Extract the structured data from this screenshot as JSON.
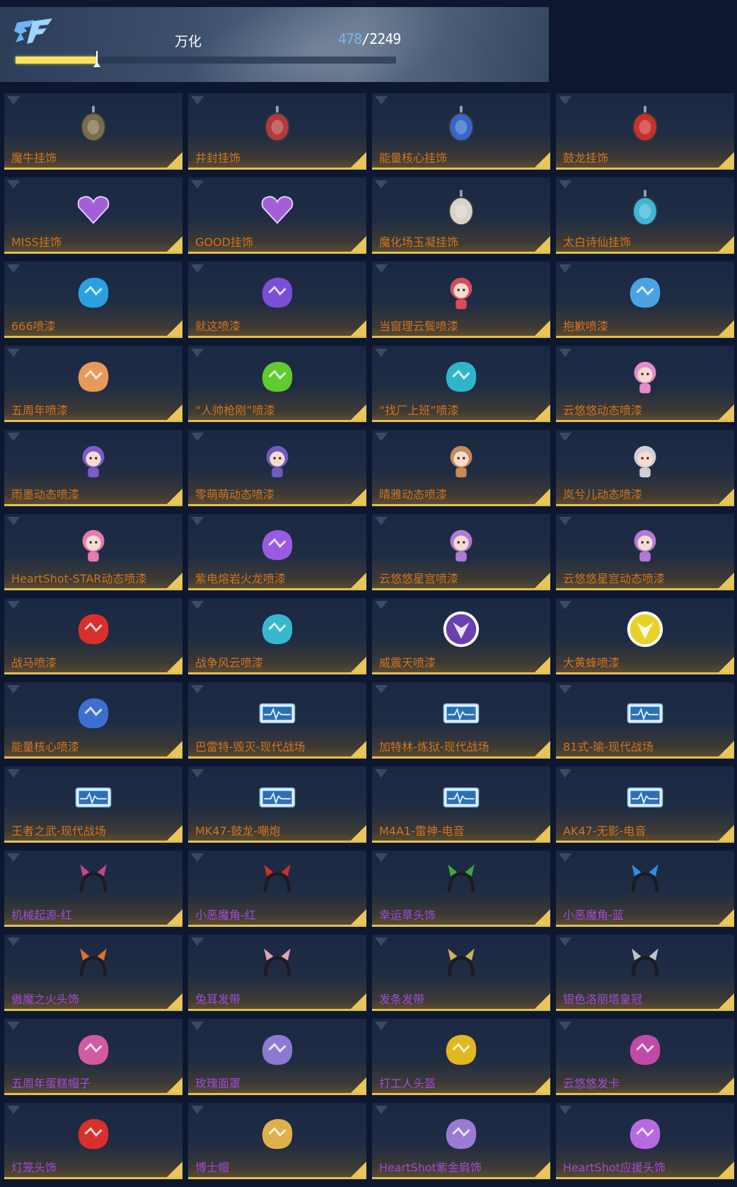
{
  "header": {
    "player_name": "万化",
    "progress_current": "478",
    "progress_separator": "/",
    "progress_total": "2249",
    "progress_fraction": 0.2125,
    "accent": "#f5e45a"
  },
  "items": [
    {
      "label": "魔牛挂饰",
      "rarity": "orange",
      "icon": "bull-charm-icon",
      "color": "#7a6e4a"
    },
    {
      "label": "井封挂饰",
      "rarity": "orange",
      "icon": "seal-charm-icon",
      "color": "#b33a3a"
    },
    {
      "label": "能量核心挂饰",
      "rarity": "orange",
      "icon": "energy-core-charm-icon",
      "color": "#3766c9"
    },
    {
      "label": "鼓龙挂饰",
      "rarity": "orange",
      "icon": "dragon-charm-icon",
      "color": "#c9302c"
    },
    {
      "label": "MISS挂饰",
      "rarity": "orange",
      "icon": "miss-heart-icon",
      "color": "#a45fd6"
    },
    {
      "label": "GOOD挂饰",
      "rarity": "orange",
      "icon": "good-heart-icon",
      "color": "#a45fd6"
    },
    {
      "label": "魔化场玉凝挂饰",
      "rarity": "orange",
      "icon": "fox-mask-icon",
      "color": "#d9d2cc"
    },
    {
      "label": "太白诗仙挂饰",
      "rarity": "orange",
      "icon": "poet-charm-icon",
      "color": "#3fb6d8"
    },
    {
      "label": "666喷漆",
      "rarity": "orange",
      "icon": "spray-666-icon",
      "color": "#2aa0e0"
    },
    {
      "label": "就这喷漆",
      "rarity": "orange",
      "icon": "star-spray-icon",
      "color": "#7b4ed6"
    },
    {
      "label": "当窗理云鬓喷漆",
      "rarity": "orange",
      "icon": "girl-spray-icon",
      "color": "#d94a5a"
    },
    {
      "label": "抱歉喷漆",
      "rarity": "orange",
      "icon": "sorry-spray-icon",
      "color": "#4aa3e0"
    },
    {
      "label": "五周年喷漆",
      "rarity": "orange",
      "icon": "anniversary-spray-icon",
      "color": "#e89a5a"
    },
    {
      "label": "“人帅枪刚”喷漆",
      "rarity": "orange",
      "icon": "green-splash-icon",
      "color": "#5ecb2e"
    },
    {
      "label": "“找厂上班”喷漆",
      "rarity": "orange",
      "icon": "cyan-splash-icon",
      "color": "#2fb5c9"
    },
    {
      "label": "云悠悠动态喷漆",
      "rarity": "orange",
      "icon": "pink-girl-icon",
      "color": "#e58bc7"
    },
    {
      "label": "雨墨动态喷漆",
      "rarity": "orange",
      "icon": "purple-girl-icon",
      "color": "#7b5cc9"
    },
    {
      "label": "零萌萌动态喷漆",
      "rarity": "orange",
      "icon": "goggle-girl-icon",
      "color": "#6f5ac0"
    },
    {
      "label": "晴雅动态喷漆",
      "rarity": "orange",
      "icon": "twin-tail-girl-icon",
      "color": "#c98a5a"
    },
    {
      "label": "岚兮儿动态喷漆",
      "rarity": "orange",
      "icon": "silver-girl-icon",
      "color": "#cfcfd8"
    },
    {
      "label": "HeartShot-STAR动态喷漆",
      "rarity": "orange",
      "icon": "heartshot-star-icon",
      "color": "#e77ab0"
    },
    {
      "label": "紫电熔岩火龙喷漆",
      "rarity": "orange",
      "icon": "purple-dragon-icon",
      "color": "#9a5be0"
    },
    {
      "label": "云悠悠星宫喷漆",
      "rarity": "orange",
      "icon": "star-palace-girl-icon",
      "color": "#b27ad6"
    },
    {
      "label": "云悠悠星宫动态喷漆",
      "rarity": "orange",
      "icon": "star-palace-girl-2-icon",
      "color": "#b27ad6"
    },
    {
      "label": "战马喷漆",
      "rarity": "orange",
      "icon": "warhorse-spray-icon",
      "color": "#d9302c"
    },
    {
      "label": "战争风云喷漆",
      "rarity": "orange",
      "icon": "drone-spray-icon",
      "color": "#38b8d0"
    },
    {
      "label": "威震天喷漆",
      "rarity": "orange",
      "icon": "decepticon-icon",
      "color": "#6a3fb0"
    },
    {
      "label": "大黄蜂喷漆",
      "rarity": "orange",
      "icon": "autobot-icon",
      "color": "#e9d12a"
    },
    {
      "label": "能量核心喷漆",
      "rarity": "orange",
      "icon": "mech-spray-icon",
      "color": "#3c6fd0"
    },
    {
      "label": "巴雷特-毁灭-现代战场",
      "rarity": "orange",
      "icon": "weapon-card-icon",
      "color": "#9fd1f0"
    },
    {
      "label": "加特林-炼狱-现代战场",
      "rarity": "orange",
      "icon": "weapon-card-icon",
      "color": "#9fd1f0"
    },
    {
      "label": "81式-瑜-现代战场",
      "rarity": "orange",
      "icon": "weapon-card-icon",
      "color": "#9fd1f0"
    },
    {
      "label": "王者之武-现代战场",
      "rarity": "orange",
      "icon": "weapon-card-icon",
      "color": "#9fd1f0"
    },
    {
      "label": "MK47-鼓龙-嘲炮",
      "rarity": "orange",
      "icon": "weapon-card-icon",
      "color": "#9fd1f0"
    },
    {
      "label": "M4A1-雷神-电音",
      "rarity": "orange",
      "icon": "weapon-card-icon",
      "color": "#9fd1f0"
    },
    {
      "label": "AK47-无影-电音",
      "rarity": "orange",
      "icon": "weapon-card-icon",
      "color": "#9fd1f0"
    },
    {
      "label": "机械起源-红",
      "rarity": "purple",
      "icon": "cat-ear-headband-icon",
      "color": "#c0478a"
    },
    {
      "label": "小恶魔角-红",
      "rarity": "purple",
      "icon": "red-horn-headband-icon",
      "color": "#c9302c"
    },
    {
      "label": "幸运草头饰",
      "rarity": "purple",
      "icon": "clover-headband-icon",
      "color": "#3fa83a"
    },
    {
      "label": "小恶魔角-蓝",
      "rarity": "purple",
      "icon": "blue-horn-headband-icon",
      "color": "#2f8fe0"
    },
    {
      "label": "傲魔之火头饰",
      "rarity": "purple",
      "icon": "flame-headgear-icon",
      "color": "#e0702a"
    },
    {
      "label": "兔耳发带",
      "rarity": "purple",
      "icon": "bunny-ear-headband-icon",
      "color": "#e5a3b0"
    },
    {
      "label": "发条发带",
      "rarity": "purple",
      "icon": "windup-headband-icon",
      "color": "#c9b25a"
    },
    {
      "label": "银色洛丽塔皇冠",
      "rarity": "purple",
      "icon": "silver-crown-icon",
      "color": "#bfc4cc"
    },
    {
      "label": "五周年蛋糕帽子",
      "rarity": "purple",
      "icon": "cake-hat-icon",
      "color": "#d25aa0"
    },
    {
      "label": "玫瑰面罩",
      "rarity": "purple",
      "icon": "rose-mask-icon",
      "color": "#8d7ad0"
    },
    {
      "label": "打工人头盔",
      "rarity": "purple",
      "icon": "yellow-helmet-icon",
      "color": "#e0b820"
    },
    {
      "label": "云悠悠发卡",
      "rarity": "purple",
      "icon": "flower-hairpin-icon",
      "color": "#c04aa8"
    },
    {
      "label": "灯笼头饰",
      "rarity": "purple",
      "icon": "lantern-headwear-icon",
      "color": "#d9302c"
    },
    {
      "label": "博士帽",
      "rarity": "purple",
      "icon": "graduation-cap-icon",
      "color": "#e0b04a"
    },
    {
      "label": "HeartShot紫金肩饰",
      "rarity": "purple",
      "icon": "shoulder-armor-icon",
      "color": "#9a7ad6"
    },
    {
      "label": "HeartShot应援头饰",
      "rarity": "purple",
      "icon": "heartshot-headwear-icon",
      "color": "#b56ae0"
    }
  ]
}
